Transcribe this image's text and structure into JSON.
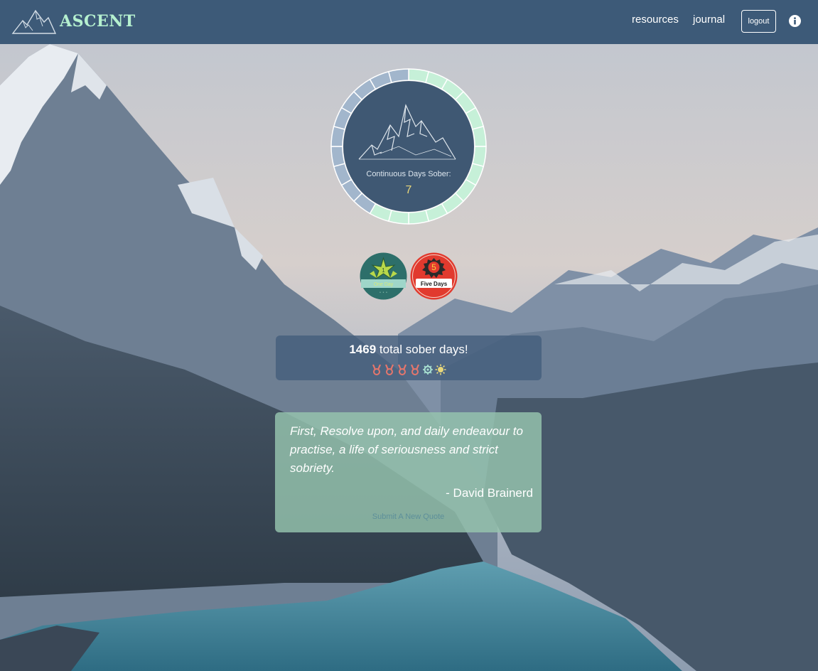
{
  "brand": {
    "name": "ASCENT"
  },
  "nav": {
    "resources_label": "resources",
    "journal_label": "journal",
    "logout_label": "logout"
  },
  "tracker": {
    "continuous_label": "Continuous Days Sober:",
    "continuous_days": "7",
    "ring_segments_total": 24,
    "ring_segments_filled": 14,
    "filled_color": "#c6f0d8",
    "empty_color": "#a2b6cc"
  },
  "badges": [
    {
      "name": "one-day-badge",
      "number": "1",
      "label": "One Day",
      "color": "#2d6f6a"
    },
    {
      "name": "five-days-badge",
      "number": "5",
      "label": "Five Days",
      "color": "#e13a2e"
    }
  ],
  "totals": {
    "count": "1469",
    "suffix": " total sober days!",
    "medals": [
      "medal-icon",
      "medal-icon",
      "medal-icon",
      "medal-icon",
      "gear-icon",
      "sun-icon"
    ]
  },
  "quote": {
    "text": "First, Resolve upon, and daily endeavour to practise, a life of seriousness and strict sobriety.",
    "author": "- David Brainerd",
    "submit_label": "Submit A New Quote"
  },
  "colors": {
    "navbar": "#3d5a78",
    "brand_text": "#b5f0cf",
    "medal": "#e5766c",
    "gear": "#a9e2d2",
    "sun": "#e8d77a"
  }
}
